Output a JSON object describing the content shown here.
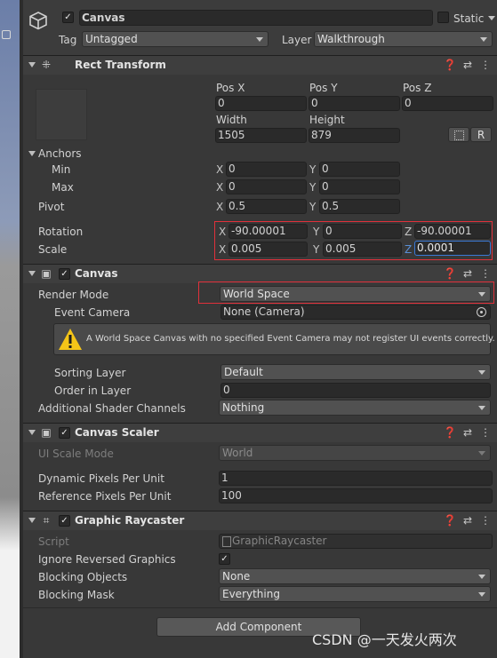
{
  "object": {
    "name": "Canvas",
    "static_label": "Static",
    "tag_label": "Tag",
    "tag_value": "Untagged",
    "layer_label": "Layer",
    "layer_value": "Walkthrough"
  },
  "rect_transform": {
    "title": "Rect Transform",
    "pos_x_label": "Pos X",
    "pos_y_label": "Pos Y",
    "pos_z_label": "Pos Z",
    "pos_x": "0",
    "pos_y": "0",
    "pos_z": "0",
    "width_label": "Width",
    "height_label": "Height",
    "width": "1505",
    "height": "879",
    "r_button": "R",
    "anchors_label": "Anchors",
    "min_label": "Min",
    "max_label": "Max",
    "min_x": "0",
    "min_y": "0",
    "max_x": "0",
    "max_y": "0",
    "pivot_label": "Pivot",
    "pivot_x": "0.5",
    "pivot_y": "0.5",
    "rotation_label": "Rotation",
    "rot_x": "-90.00001",
    "rot_y": "0",
    "rot_z": "-90.00001",
    "scale_label": "Scale",
    "scale_x": "0.005",
    "scale_y": "0.005",
    "scale_z": "0.0001",
    "x": "X",
    "y": "Y",
    "z": "Z"
  },
  "canvas": {
    "title": "Canvas",
    "render_mode_label": "Render Mode",
    "render_mode": "World Space",
    "event_camera_label": "Event Camera",
    "event_camera": "None (Camera)",
    "warning": "A World Space Canvas with no specified Event Camera may not register UI events correctly.",
    "sorting_layer_label": "Sorting Layer",
    "sorting_layer": "Default",
    "order_label": "Order in Layer",
    "order": "0",
    "shader_label": "Additional Shader Channels",
    "shader": "Nothing"
  },
  "canvas_scaler": {
    "title": "Canvas Scaler",
    "ui_scale_label": "UI Scale Mode",
    "ui_scale": "World",
    "dynamic_label": "Dynamic Pixels Per Unit",
    "dynamic": "1",
    "reference_label": "Reference Pixels Per Unit",
    "reference": "100"
  },
  "raycaster": {
    "title": "Graphic Raycaster",
    "script_label": "Script",
    "script": "GraphicRaycaster",
    "ignore_label": "Ignore Reversed Graphics",
    "blocking_objects_label": "Blocking Objects",
    "blocking_objects": "None",
    "blocking_mask_label": "Blocking Mask",
    "blocking_mask": "Everything"
  },
  "add_component": "Add Component",
  "watermark": "CSDN @一天发火两次",
  "colors": {
    "highlight_box": "#e0303a",
    "warning_icon": "#f5c518"
  }
}
